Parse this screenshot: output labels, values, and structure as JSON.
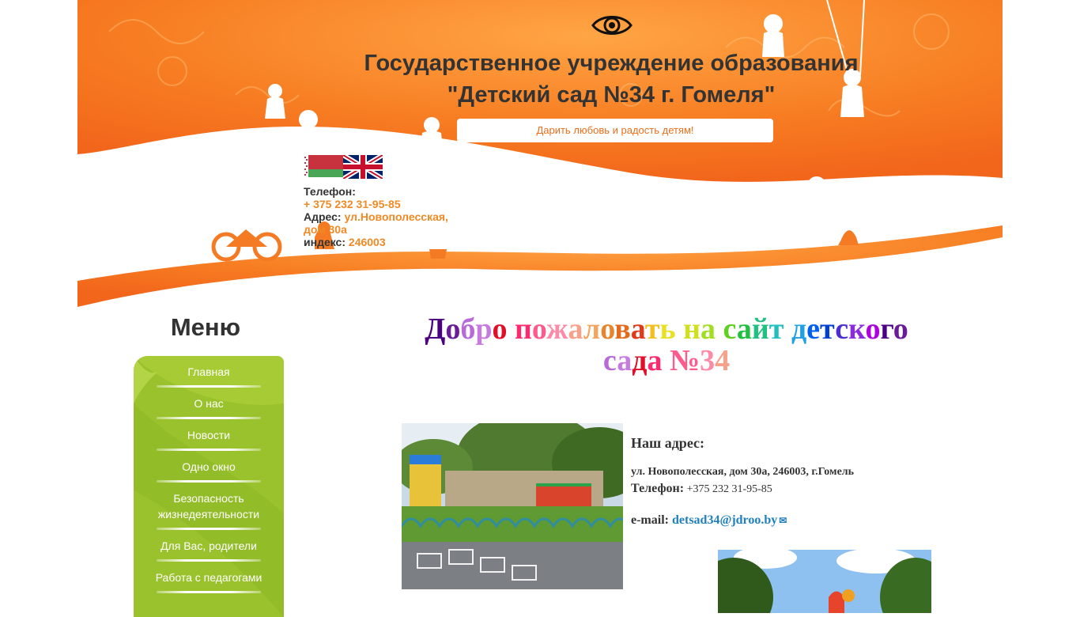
{
  "header": {
    "title_line1": "Государственное учреждение образования",
    "title_line2": "\"Детский сад №34 г. Гомеля\"",
    "slogan": "Дарить любовь и радость детям!",
    "accessibility_icon": "eye-icon",
    "flags": [
      "belarus-flag-icon",
      "uk-flag-icon"
    ],
    "contacts": {
      "phone_label": "Телефон:",
      "phone_value": " + 375 232  31-95-85",
      "address_label": "Адрес:",
      "address_value": "ул.Новополесская, дом 30а",
      "index_label": "индекс:",
      "index_value": "246003"
    },
    "colors": {
      "orange": "#f6731f",
      "orange_light": "#ffa545",
      "text": "#333333"
    }
  },
  "menu": {
    "heading": "Меню",
    "bg_color": "#9ac22d",
    "items": [
      {
        "label": "Главная"
      },
      {
        "label": "О нас"
      },
      {
        "label": "Новости"
      },
      {
        "label": "Одно окно"
      },
      {
        "label": "Безопасность жизнедеятельности"
      },
      {
        "label": "Для Вас, родители"
      },
      {
        "label": "Работа с педагогами"
      }
    ]
  },
  "main": {
    "welcome_line1": "Добро пожаловать на сайт детского",
    "welcome_line2": "сада №34",
    "rainbow_colors": [
      "#4b0082",
      "#6a1b9a",
      "#b86bd8",
      "#c77be0",
      "#e0102a",
      "#ff2a6d",
      "#ff5a8c",
      "#ff8aa8",
      "#f7a18a",
      "#f4a460",
      "#e8842c",
      "#e46a1e",
      "#e03a1a",
      "#f0c020",
      "#e8e020",
      "#d0e020",
      "#a0e020",
      "#60d020",
      "#20c040",
      "#20c080",
      "#20c0c0",
      "#20a0e0",
      "#0060f0",
      "#0040d0",
      "#4b2fd0",
      "#8a2be2",
      "#b000e0"
    ],
    "address": {
      "heading": "Наш адрес:",
      "street": "ул. Новополесская, дом 30а, 246003, г.Гомель",
      "phone_label": "Телефон:",
      "phone_value": " +375 232 31-95-85",
      "email_label": "e-mail:",
      "email_value": "detsad34@jdroo.by",
      "email_icon": "mail-icon"
    },
    "photos": [
      "playground-photo",
      "inflatable-photo"
    ]
  }
}
